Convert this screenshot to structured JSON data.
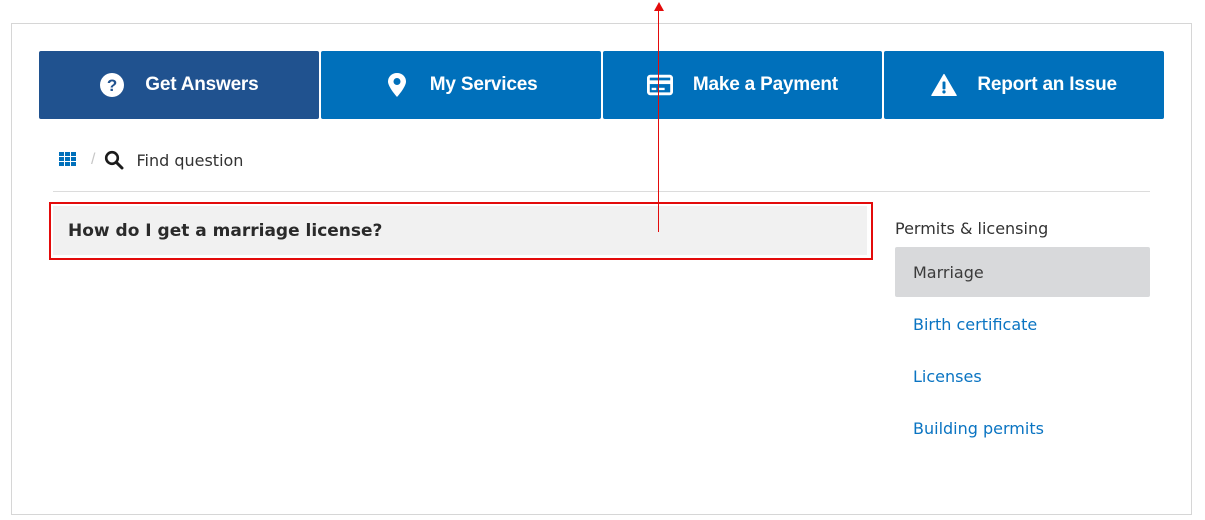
{
  "nav": {
    "buttons": [
      {
        "label": "Get Answers",
        "icon": "question-circle-icon",
        "active": true
      },
      {
        "label": "My Services",
        "icon": "map-pin-icon",
        "active": false
      },
      {
        "label": "Make a Payment",
        "icon": "credit-card-icon",
        "active": false
      },
      {
        "label": "Report an Issue",
        "icon": "warning-triangle-icon",
        "active": false
      }
    ]
  },
  "breadcrumb": {
    "home_icon": "grid-icon",
    "separator": "/",
    "search_icon": "search-icon",
    "current": "Find question"
  },
  "question": {
    "value": "How do I get a marriage license?"
  },
  "sidebar": {
    "heading": "Permits & licensing",
    "items": [
      {
        "label": "Marriage",
        "selected": true
      },
      {
        "label": "Birth certificate",
        "selected": false
      },
      {
        "label": "Licenses",
        "selected": false
      },
      {
        "label": "Building permits",
        "selected": false
      }
    ]
  },
  "colors": {
    "nav_active": "#20528f",
    "nav_default": "#0070bb",
    "link": "#0a74c2",
    "selected_bg": "#d8d9db",
    "annotation": "#e30b0b"
  }
}
